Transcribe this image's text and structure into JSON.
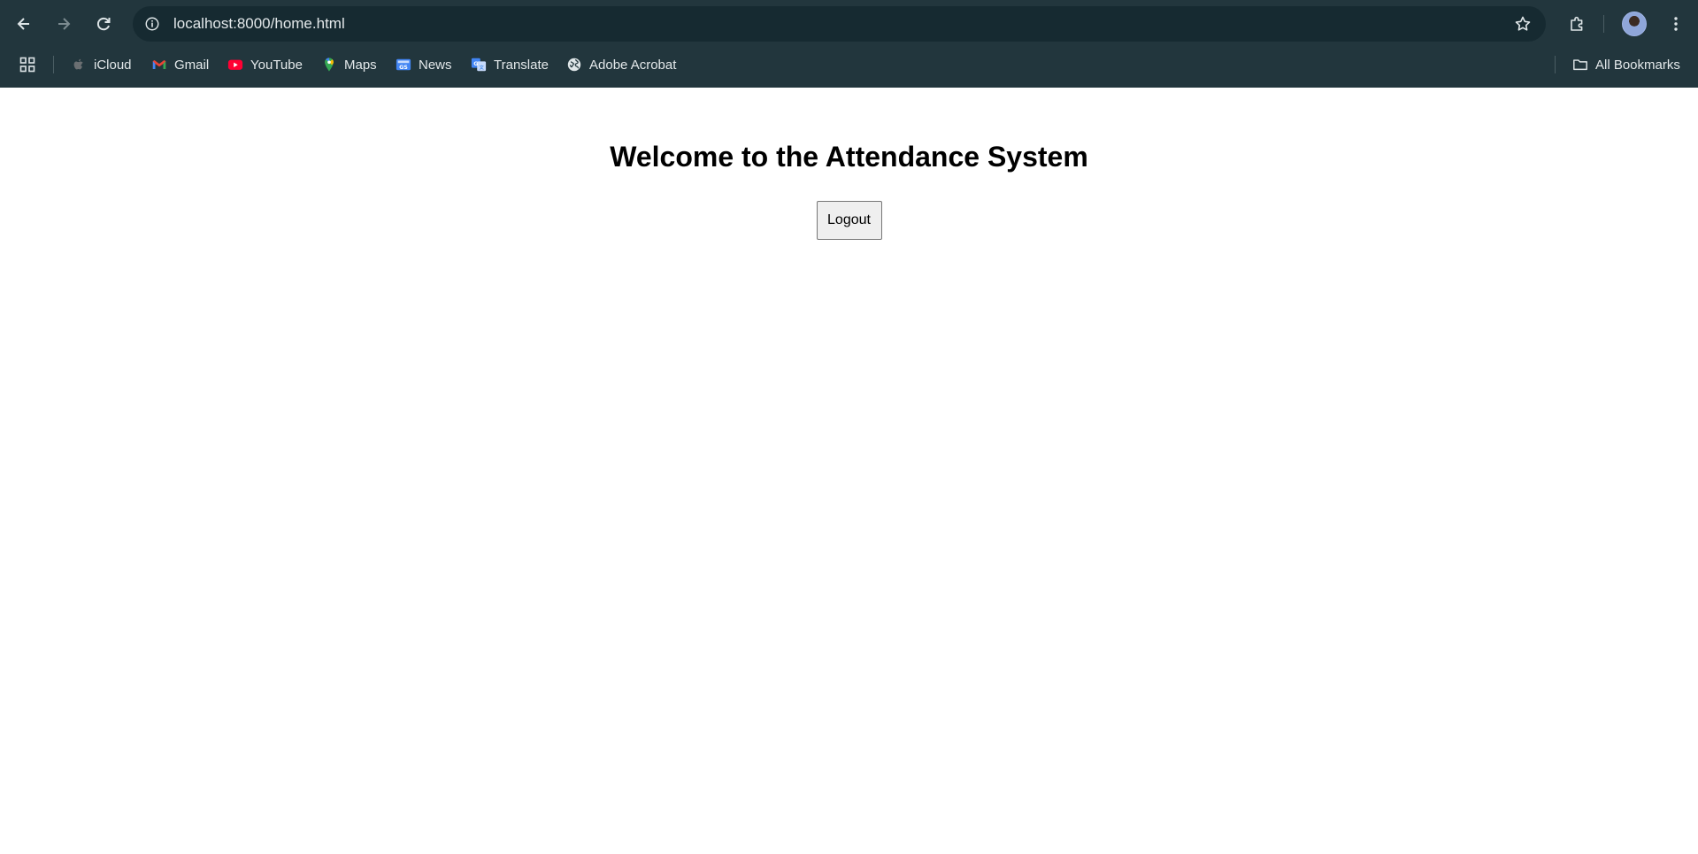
{
  "browser": {
    "url": "localhost:8000/home.html",
    "bookmarks": [
      {
        "label": "iCloud",
        "icon": "apple-icon"
      },
      {
        "label": "Gmail",
        "icon": "gmail-icon"
      },
      {
        "label": "YouTube",
        "icon": "youtube-icon"
      },
      {
        "label": "Maps",
        "icon": "maps-icon"
      },
      {
        "label": "News",
        "icon": "news-icon"
      },
      {
        "label": "Translate",
        "icon": "translate-icon"
      },
      {
        "label": "Adobe Acrobat",
        "icon": "globe-icon"
      }
    ],
    "all_bookmarks_label": "All Bookmarks",
    "colors": {
      "toolbar": "#22363d",
      "omnibox": "#162a31",
      "text": "#e3e8ea"
    }
  },
  "page": {
    "heading": "Welcome to the Attendance System",
    "logout_label": "Logout"
  }
}
